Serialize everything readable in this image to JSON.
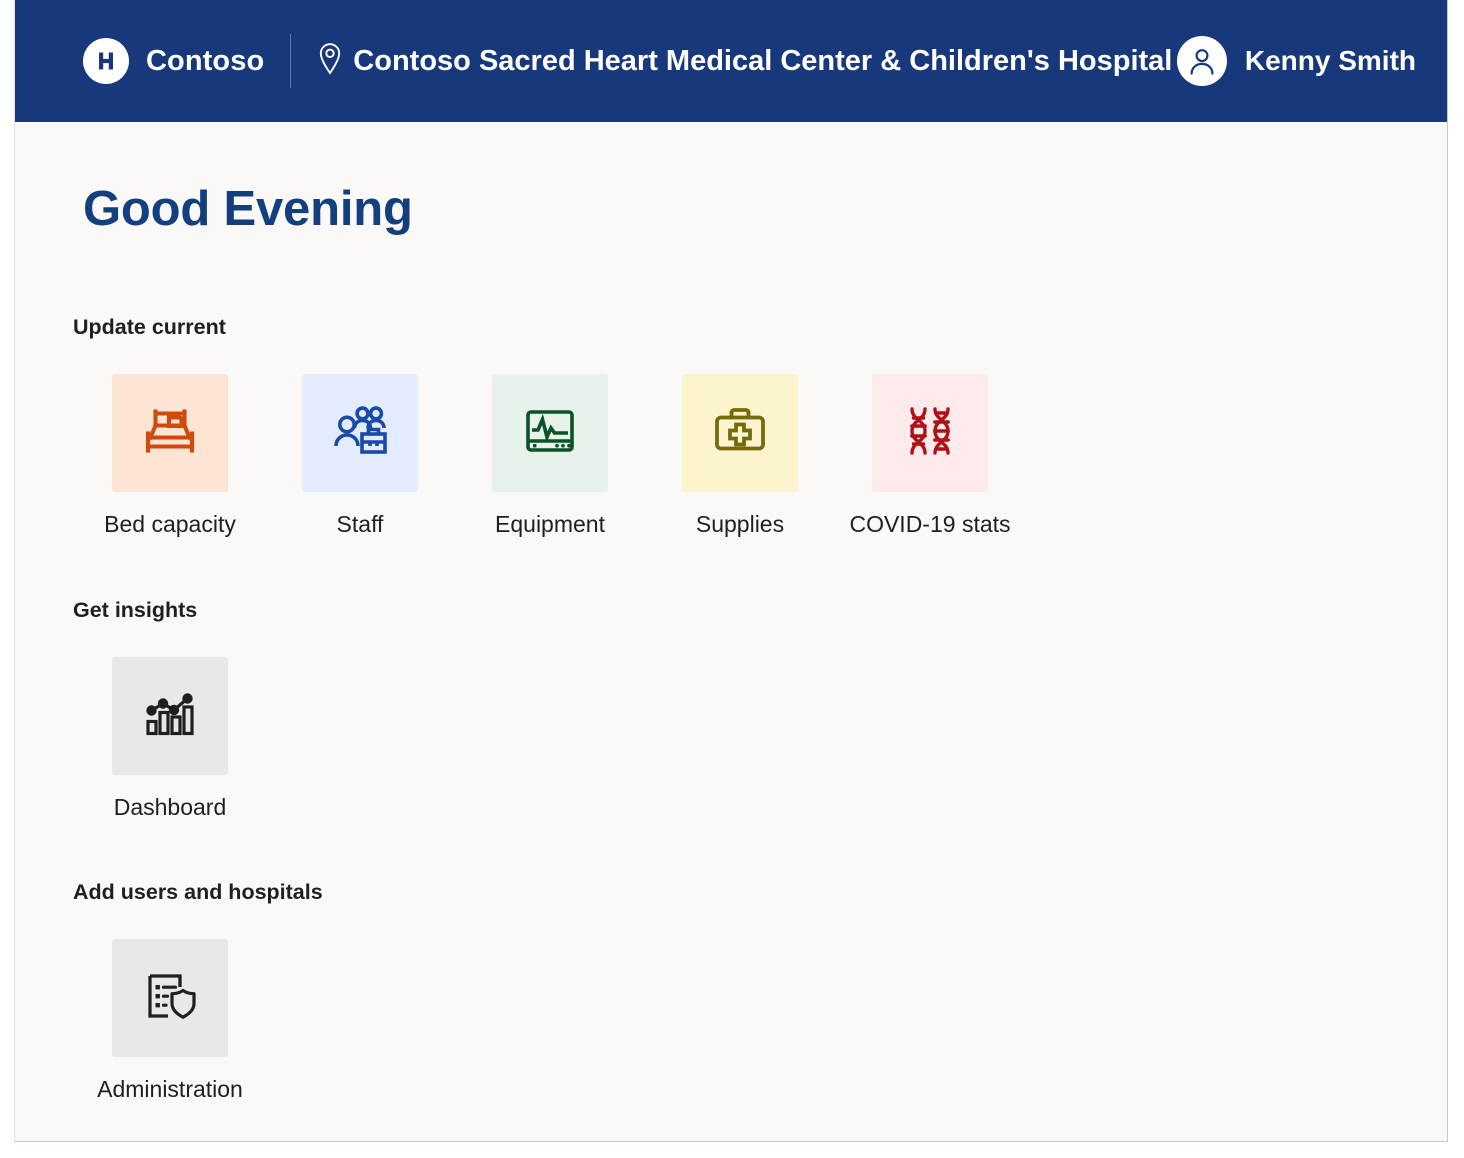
{
  "header": {
    "logo_icon": "hospital-h-logo-icon",
    "brand_name": "Contoso",
    "location_icon": "location-pin-icon",
    "facility_name": "Contoso Sacred Heart Medical Center & Children's Hospital",
    "avatar_icon": "person-avatar-icon",
    "user_name": "Kenny Smith",
    "background_color": "#17387a",
    "text_color": "#ffffff"
  },
  "page": {
    "greeting": "Good Evening",
    "greeting_color": "#12407f",
    "background_color": "#faf9f8"
  },
  "sections": [
    {
      "heading": "Update current",
      "tiles": [
        {
          "label": "Bed capacity",
          "icon": "bed-icon",
          "icon_color": "#d04a0b",
          "tile_color": "#fde4d3"
        },
        {
          "label": "Staff",
          "icon": "people-with-briefcase-icon",
          "icon_color": "#1a4aa8",
          "tile_color": "#e3ecfd"
        },
        {
          "label": "Equipment",
          "icon": "vitals-monitor-icon",
          "icon_color": "#0b5227",
          "tile_color": "#e6f2ea"
        },
        {
          "label": "Supplies",
          "icon": "medical-kit-icon",
          "icon_color": "#766b09",
          "tile_color": "#fcf3cf"
        },
        {
          "label": "COVID-19 stats",
          "icon": "dna-helix-icon",
          "icon_color": "#b01116",
          "tile_color": "#fdeaea"
        }
      ]
    },
    {
      "heading": "Get insights",
      "tiles": [
        {
          "label": "Dashboard",
          "icon": "bar-chart-trendline-icon",
          "icon_color": "#201f1e",
          "tile_color": "#e8e8e8"
        }
      ]
    },
    {
      "heading": "Add users and hospitals",
      "tiles": [
        {
          "label": "Administration",
          "icon": "list-with-shield-icon",
          "icon_color": "#201f1e",
          "tile_color": "#e8e8e8"
        }
      ]
    }
  ]
}
